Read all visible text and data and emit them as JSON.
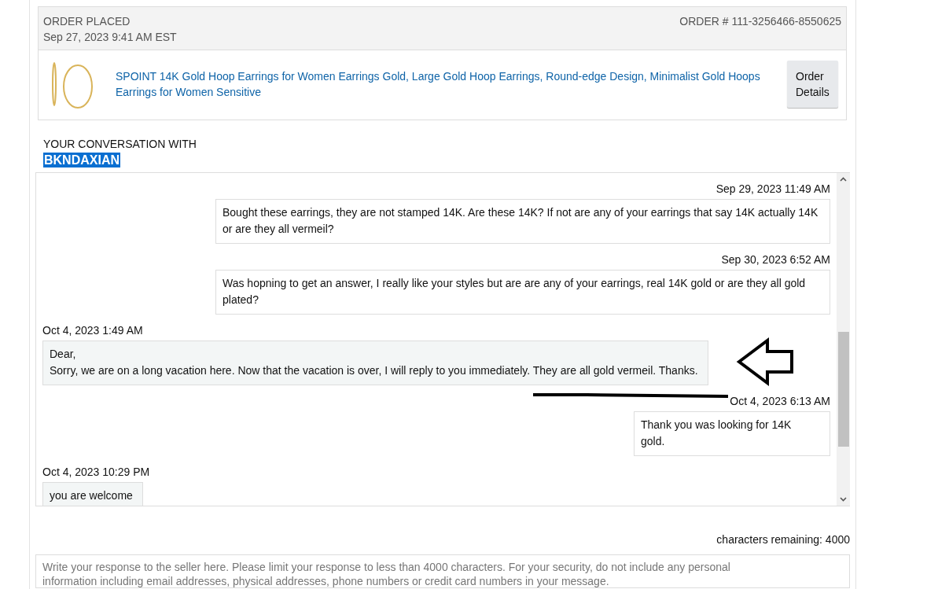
{
  "order": {
    "placed_label": "ORDER PLACED",
    "placed_date": "Sep 27, 2023 9:41 AM EST",
    "order_number": "ORDER # 111-3256466-8550625",
    "product_title": "SPOINT 14K Gold Hoop Earrings for Women Earrings Gold, Large Gold Hoop Earrings, Round-edge Design, Minimalist Gold Hoops Earrings for Women Sensitive",
    "details_button": "Order Details"
  },
  "conversation": {
    "heading": "YOUR CONVERSATION WITH",
    "seller": "BKNDAXIAN",
    "seller_selected": true
  },
  "messages": [
    {
      "kind": "buyer",
      "time": "Sep 29, 2023 11:49 AM",
      "text": "Bought these earrings, they are not stamped 14K. Are these 14K? If not are any of your earrings that say 14K actually 14K or are they all vermeil?"
    },
    {
      "kind": "buyer",
      "time": "Sep 30, 2023 6:52 AM",
      "text": "Was hopning to get an answer, I really like your styles but are are any of your earrings, real 14K gold or are they all gold plated?"
    },
    {
      "kind": "seller",
      "time": "Oct 4, 2023 1:49 AM",
      "text": "Dear,\nSorry, we are on a long vacation here. Now that the vacation is over, I will reply to you immediately. They are all gold vermeil. Thanks."
    },
    {
      "kind": "buyer",
      "time": "Oct 4, 2023 6:13 AM",
      "text": "Thank you was looking for 14K gold."
    },
    {
      "kind": "seller",
      "time": "Oct 4, 2023 10:29 PM",
      "text": "you are welcome"
    }
  ],
  "reply": {
    "remaining": "characters remaining: 4000",
    "placeholder": "Write your response to the seller here. Please limit your response to less than 4000 characters. For your security, do not include any personal information including email addresses, physical addresses, phone numbers or credit card numbers in your message."
  }
}
